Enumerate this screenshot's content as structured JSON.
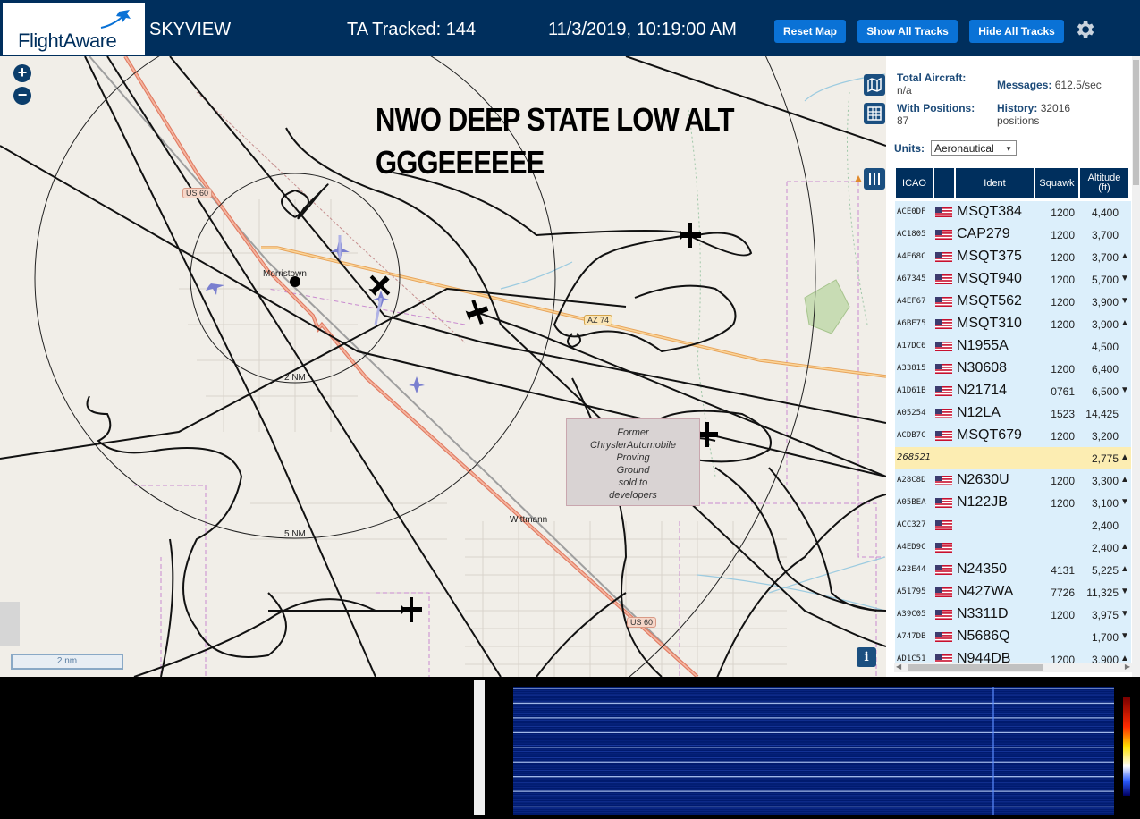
{
  "header": {
    "logo": "FlightAware",
    "app_title": "SKYVIEW",
    "tracked": "TA Tracked: 144",
    "datetime": "11/3/2019, 10:19:00 AM",
    "buttons": {
      "reset": "Reset Map",
      "show": "Show All Tracks",
      "hide": "Hide All Tracks"
    },
    "settings_icon": "gear-icon",
    "colors": {
      "bar": "#002f5d",
      "button": "#0a72d6"
    }
  },
  "map": {
    "zoom_in": "+",
    "zoom_out": "−",
    "overlay_line1": "NWO DEEP STATE LOW ALT",
    "overlay_line2": "GGGEEEEEE",
    "places": {
      "morristown": "Morristown",
      "wittmann": "Wittmann"
    },
    "highways": {
      "us60_a": "US 60",
      "us60_b": "US 60",
      "az74": "AZ 74"
    },
    "rings": {
      "r2": "2 NM",
      "r5": "5 NM"
    },
    "former_site": [
      "Former",
      "ChryslerAutomobile",
      "Proving",
      "Ground",
      "sold to",
      "developers"
    ],
    "scale": "2 nm",
    "info": "i"
  },
  "panel": {
    "total_label": "Total Aircraft:",
    "total_value": "n/a",
    "messages_label": "Messages:",
    "messages_value": "612.5/sec",
    "positions_label": "With Positions:",
    "positions_value": "87",
    "history_label": "History:",
    "history_value": "32016",
    "history_unit": "positions",
    "units_label": "Units:",
    "units_value": "Aeronautical",
    "columns": {
      "icao": "ICAO",
      "ident": "Ident",
      "squawk": "Squawk",
      "alt1": "Altitude",
      "alt2": "(ft)"
    },
    "rows": [
      {
        "icao": "ACE0DF",
        "ident": "MSQT384",
        "squawk": "1200",
        "alt": "4,400",
        "vr": ""
      },
      {
        "icao": "AC1805",
        "ident": "CAP279",
        "squawk": "1200",
        "alt": "3,700",
        "vr": ""
      },
      {
        "icao": "A4E68C",
        "ident": "MSQT375",
        "squawk": "1200",
        "alt": "3,700",
        "vr": "▲"
      },
      {
        "icao": "A67345",
        "ident": "MSQT940",
        "squawk": "1200",
        "alt": "5,700",
        "vr": "▼"
      },
      {
        "icao": "A4EF67",
        "ident": "MSQT562",
        "squawk": "1200",
        "alt": "3,900",
        "vr": "▼"
      },
      {
        "icao": "A6BE75",
        "ident": "MSQT310",
        "squawk": "1200",
        "alt": "3,900",
        "vr": "▲"
      },
      {
        "icao": "A17DC6",
        "ident": "N1955A",
        "squawk": "",
        "alt": "4,500",
        "vr": ""
      },
      {
        "icao": "A33815",
        "ident": "N30608",
        "squawk": "1200",
        "alt": "6,400",
        "vr": ""
      },
      {
        "icao": "A1D61B",
        "ident": "N21714",
        "squawk": "0761",
        "alt": "6,500",
        "vr": "▼"
      },
      {
        "icao": "A05254",
        "ident": "N12LA",
        "squawk": "1523",
        "alt": "14,425",
        "vr": ""
      },
      {
        "icao": "ACDB7C",
        "ident": "MSQT679",
        "squawk": "1200",
        "alt": "3,200",
        "vr": ""
      },
      {
        "icao": "268521",
        "ident": "",
        "squawk": "",
        "alt": "2,775",
        "vr": "▲",
        "highlight": true,
        "noflag": true
      },
      {
        "icao": "A28C8D",
        "ident": "N2630U",
        "squawk": "1200",
        "alt": "3,300",
        "vr": "▲"
      },
      {
        "icao": "A05BEA",
        "ident": "N122JB",
        "squawk": "1200",
        "alt": "3,100",
        "vr": "▼"
      },
      {
        "icao": "ACC327",
        "ident": "",
        "squawk": "",
        "alt": "2,400",
        "vr": ""
      },
      {
        "icao": "A4ED9C",
        "ident": "",
        "squawk": "",
        "alt": "2,400",
        "vr": "▲"
      },
      {
        "icao": "A23E44",
        "ident": "N24350",
        "squawk": "4131",
        "alt": "5,225",
        "vr": "▲"
      },
      {
        "icao": "A51795",
        "ident": "N427WA",
        "squawk": "7726",
        "alt": "11,325",
        "vr": "▼"
      },
      {
        "icao": "A39C05",
        "ident": "N3311D",
        "squawk": "1200",
        "alt": "3,975",
        "vr": "▼"
      },
      {
        "icao": "A747DB",
        "ident": "N5686Q",
        "squawk": "",
        "alt": "1,700",
        "vr": "▼"
      },
      {
        "icao": "AD1C51",
        "ident": "N944DB",
        "squawk": "1200",
        "alt": "3,900",
        "vr": "▲"
      }
    ]
  }
}
